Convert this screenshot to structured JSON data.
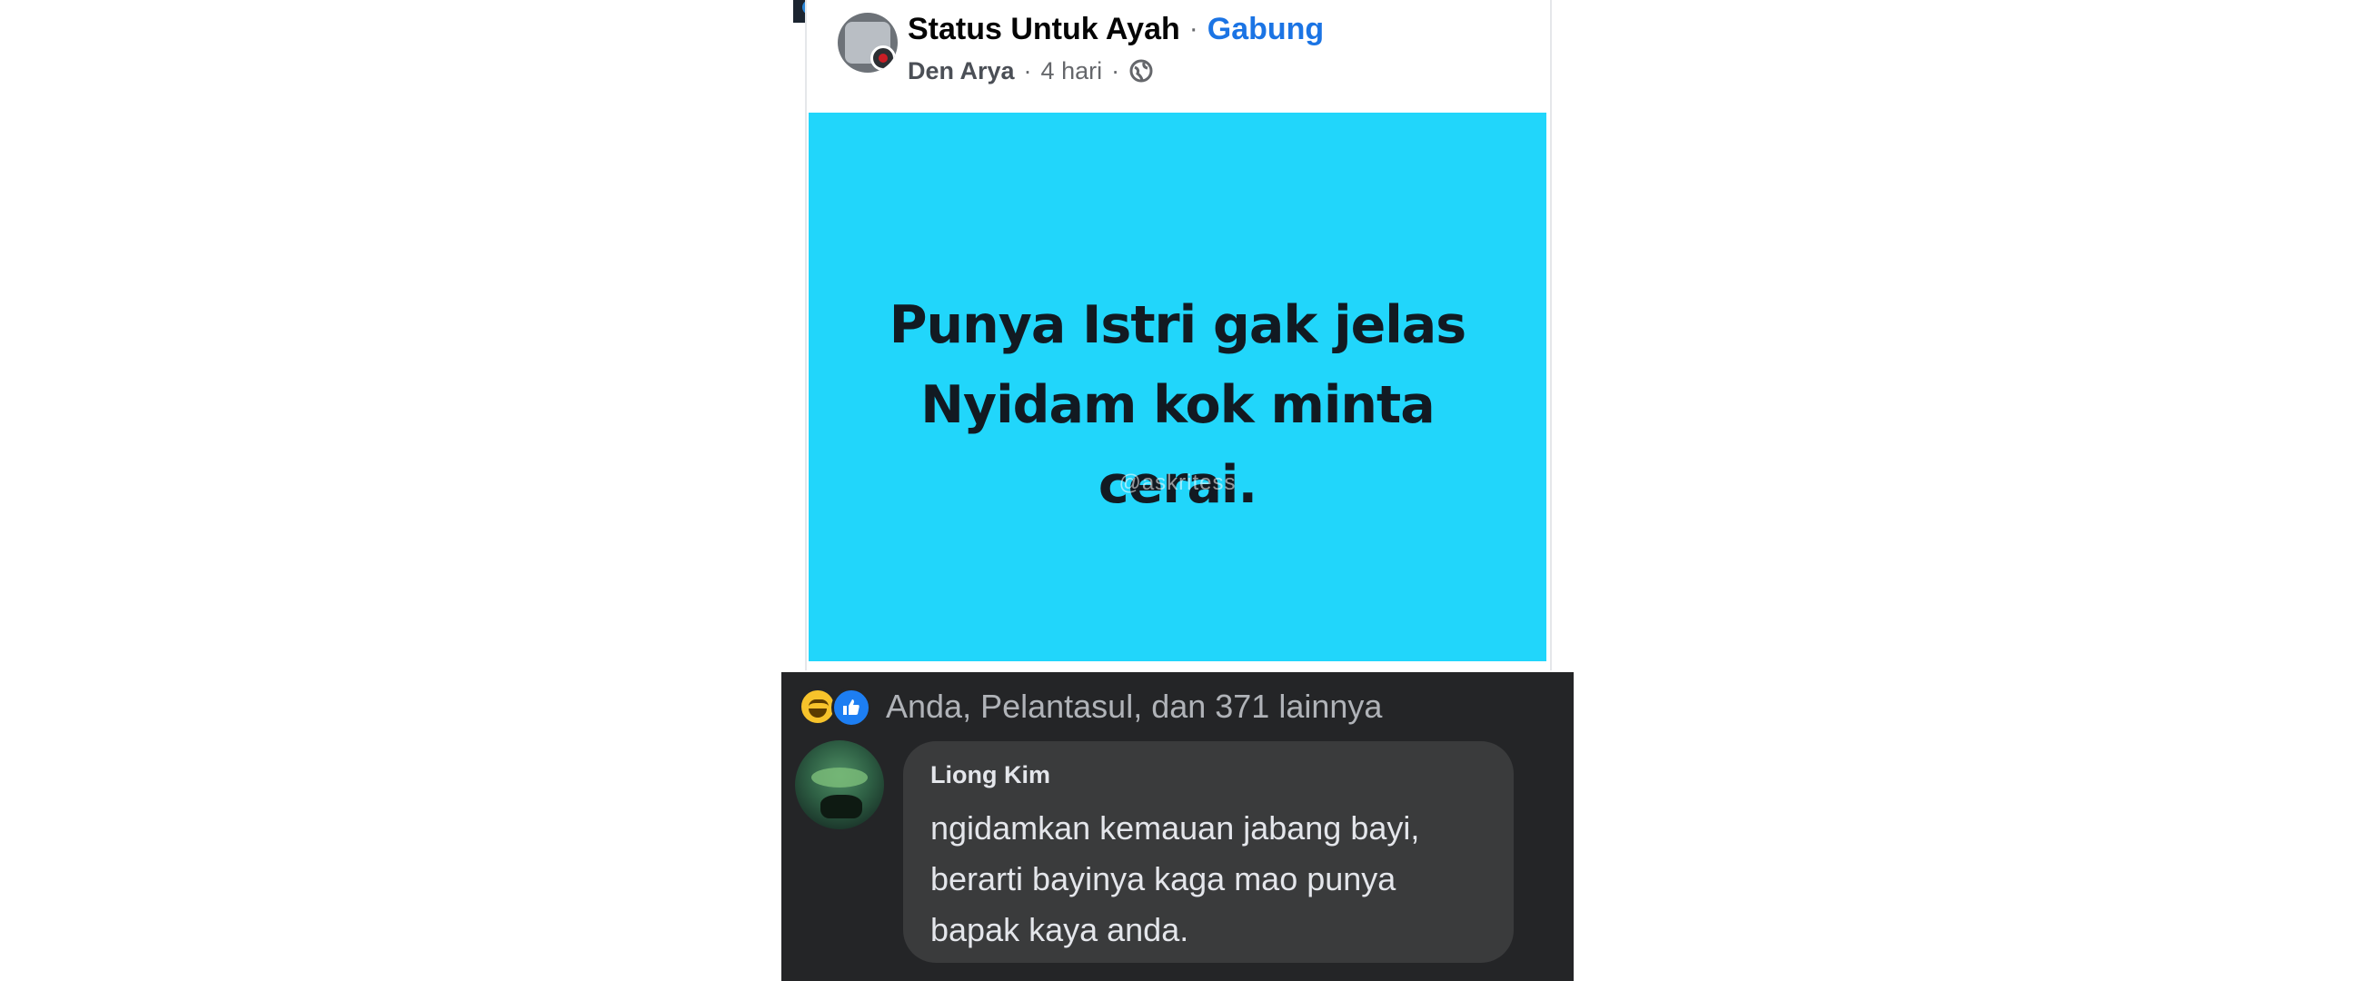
{
  "post": {
    "group_name": "Status Untuk Ayah",
    "separator": "·",
    "join_label": "Gabung",
    "author": "Den Arya",
    "time": "4 hari",
    "image_bg_color": "#21d6fb",
    "image_text_lines": [
      "Punya Istri gak jelas",
      "Nyidam kok minta",
      "cerai."
    ],
    "watermark": "@askritess"
  },
  "reactions": {
    "icons": [
      "haha-icon",
      "like-icon"
    ],
    "text": "Anda, Pelantasul, dan 371 lainnya"
  },
  "comment": {
    "author": "Liong Kim",
    "text_lines": [
      "ngidamkan kemauan jabang bayi,",
      "berarti bayinya kaga mao punya",
      "bapak kaya anda."
    ]
  }
}
